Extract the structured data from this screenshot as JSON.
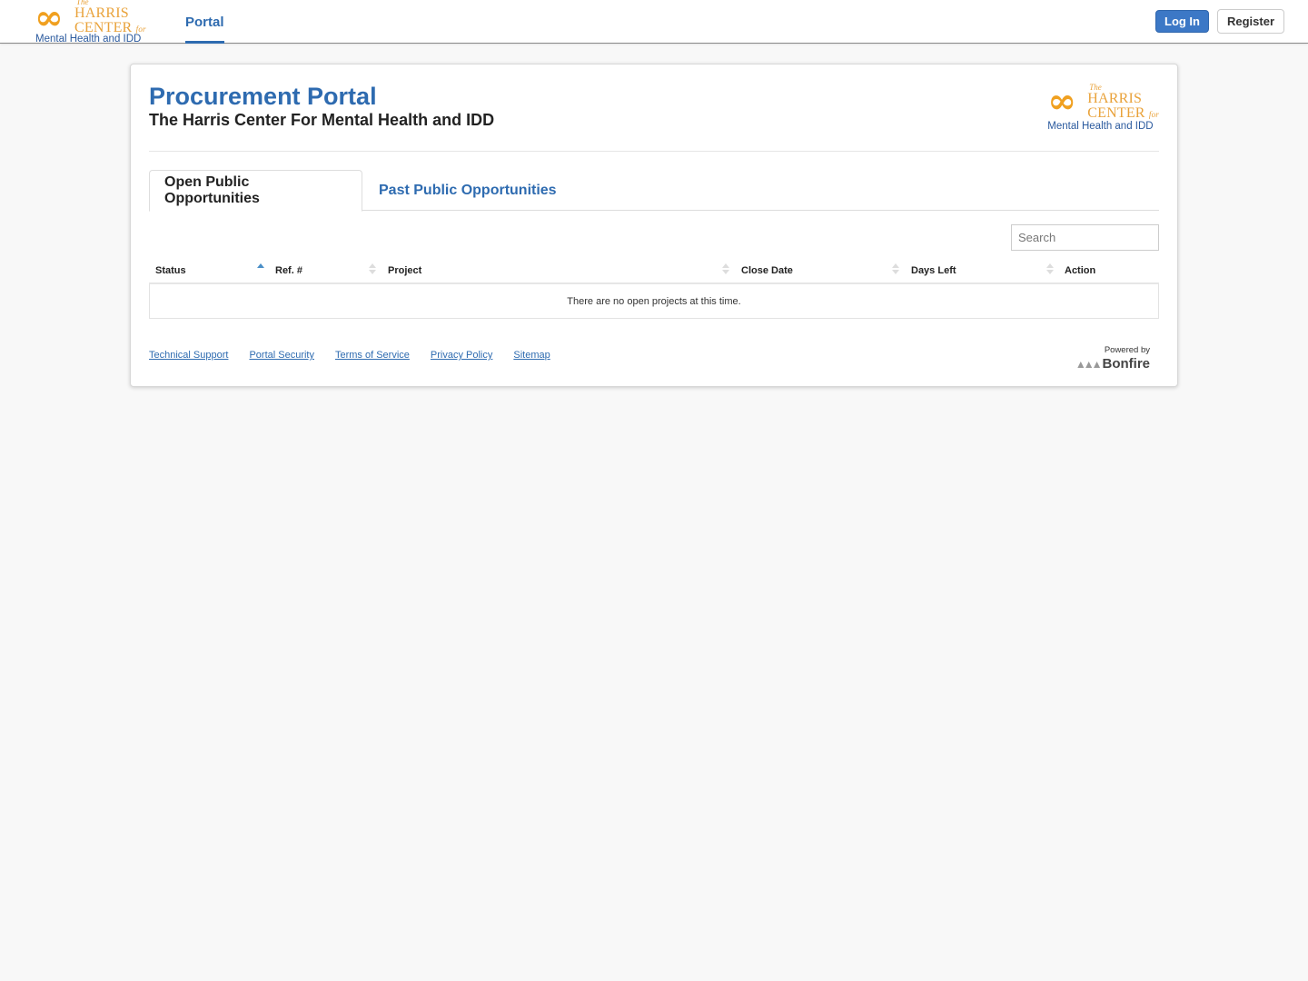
{
  "brand": {
    "logo_the": "The",
    "logo_harris": "HARRIS",
    "logo_center": "CENTER",
    "logo_for": "for",
    "logo_tagline": "Mental Health and IDD",
    "logo_mark": "ꝸꝸ",
    "colors": {
      "orange": "#e9a23a",
      "blue": "#2e6bb0"
    }
  },
  "topnav": {
    "portal_label": "Portal",
    "login_label": "Log In",
    "register_label": "Register"
  },
  "header": {
    "title": "Procurement Portal",
    "subtitle": "The Harris Center For Mental Health and IDD"
  },
  "tabs": [
    {
      "label": "Open Public Opportunities",
      "active": true
    },
    {
      "label": "Past Public Opportunities",
      "active": false
    }
  ],
  "search": {
    "placeholder": "Search",
    "value": ""
  },
  "table": {
    "columns": [
      {
        "label": "Status",
        "sort": "asc"
      },
      {
        "label": "Ref. #",
        "sort": "none"
      },
      {
        "label": "Project",
        "sort": "none"
      },
      {
        "label": "Close Date",
        "sort": "none"
      },
      {
        "label": "Days Left",
        "sort": "none"
      },
      {
        "label": "Action",
        "sort": "none"
      }
    ],
    "empty_message": "There are no open projects at this time."
  },
  "footer": {
    "links": [
      "Technical Support",
      "Portal Security",
      "Terms of Service",
      "Privacy Policy",
      "Sitemap"
    ],
    "powered_by": "Powered by",
    "powered_brand": "Bonfire",
    "powered_icon": "flame-icon"
  }
}
